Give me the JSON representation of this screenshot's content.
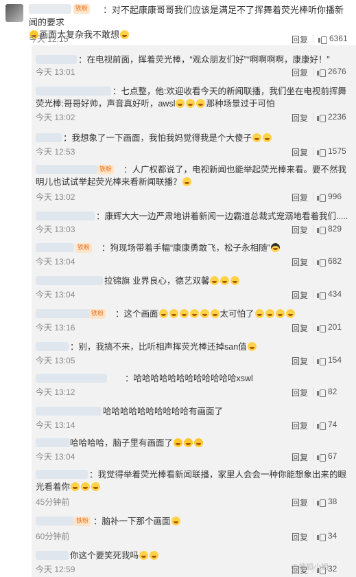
{
  "top_comment": {
    "badge": "铁粉",
    "text": "：对不起康康哥哥我们应该是满足不了挥舞着荧光棒听你播新闻的要求",
    "text2": "画面太复杂我不敢想",
    "time": "今天 12:15",
    "reply_label": "回复",
    "likes": "6361"
  },
  "replies": [
    {
      "text": "：在电视前面，挥着荧光棒，“观众朋友们好”“啊啊啊啊，康康好！”",
      "time": "今天 13:01",
      "reply_label": "回复",
      "likes": "2676"
    },
    {
      "text": "：七点整，他:欢迎收看今天的新闻联播，我们坐在电视前挥舞荧光棒:哥哥好帅，声音真好听，awsl",
      "text2": "那种场景过于可怕",
      "time": "今天 13:02",
      "reply_label": "回复",
      "likes": "2236"
    },
    {
      "text": "：我想象了一下画面，我怕我妈觉得我是个大傻子",
      "time": "今天 12:53",
      "reply_label": "回复",
      "likes": "1575"
    },
    {
      "badge": "铁粉",
      "text": "：人广权都说了，电视新闻也能举起荧光棒来看。要不然我明儿也试试举起荧光棒来看新闻联播？",
      "time": "今天 13:02",
      "reply_label": "回复",
      "likes": "996"
    },
    {
      "text": "：康辉大大一边严肃地讲着新闻一边霸道总裁式宠溺地看着我们.....",
      "time": "今天 13:03",
      "reply_label": "回复",
      "likes": "829"
    },
    {
      "badge": "铁粉",
      "text": "：狗现场带着手幅“康康勇敢飞，松子永相随”",
      "time": "今天 13:04",
      "reply_label": "回复",
      "likes": "682"
    },
    {
      "text": "拉锦旗 业界良心，德艺双馨",
      "time": "今天 13:04",
      "reply_label": "回复",
      "likes": "434"
    },
    {
      "badge": "铁粉",
      "text": "：这个画面",
      "text2": "太可怕了",
      "time": "今天 13:16",
      "reply_label": "回复",
      "likes": "201"
    },
    {
      "text": "：别，我搞不来，比听相声挥荧光棒还掉san值",
      "time": "今天 13:05",
      "reply_label": "回复",
      "likes": "154"
    },
    {
      "text": "：哈哈哈哈哈哈哈哈哈哈哈哈xswl",
      "time": "今天 13:12",
      "reply_label": "回复",
      "likes": "82"
    },
    {
      "text": "哈哈哈哈哈哈哈哈哈哈有画面了",
      "time": "今天 13:14",
      "reply_label": "回复",
      "likes": "74"
    },
    {
      "text": "哈哈哈哈，脑子里有画面了",
      "time": "今天 13:04",
      "reply_label": "回复",
      "likes": "67"
    },
    {
      "text": "：我觉得举着荧光棒看新闻联播，家里人会会一种你能想象出来的眼光看着你",
      "time": "45分钟前",
      "reply_label": "回复",
      "likes": "38"
    },
    {
      "badge": "铁粉",
      "text": "：脑补一下那个画面",
      "time": "60分钟前",
      "reply_label": "回复",
      "likes": "34"
    },
    {
      "text": "你这个要笑死我吗",
      "time": "今天 12:59",
      "reply_label": "回复",
      "likes": "32"
    }
  ],
  "watermark": "@搜狐小姐"
}
